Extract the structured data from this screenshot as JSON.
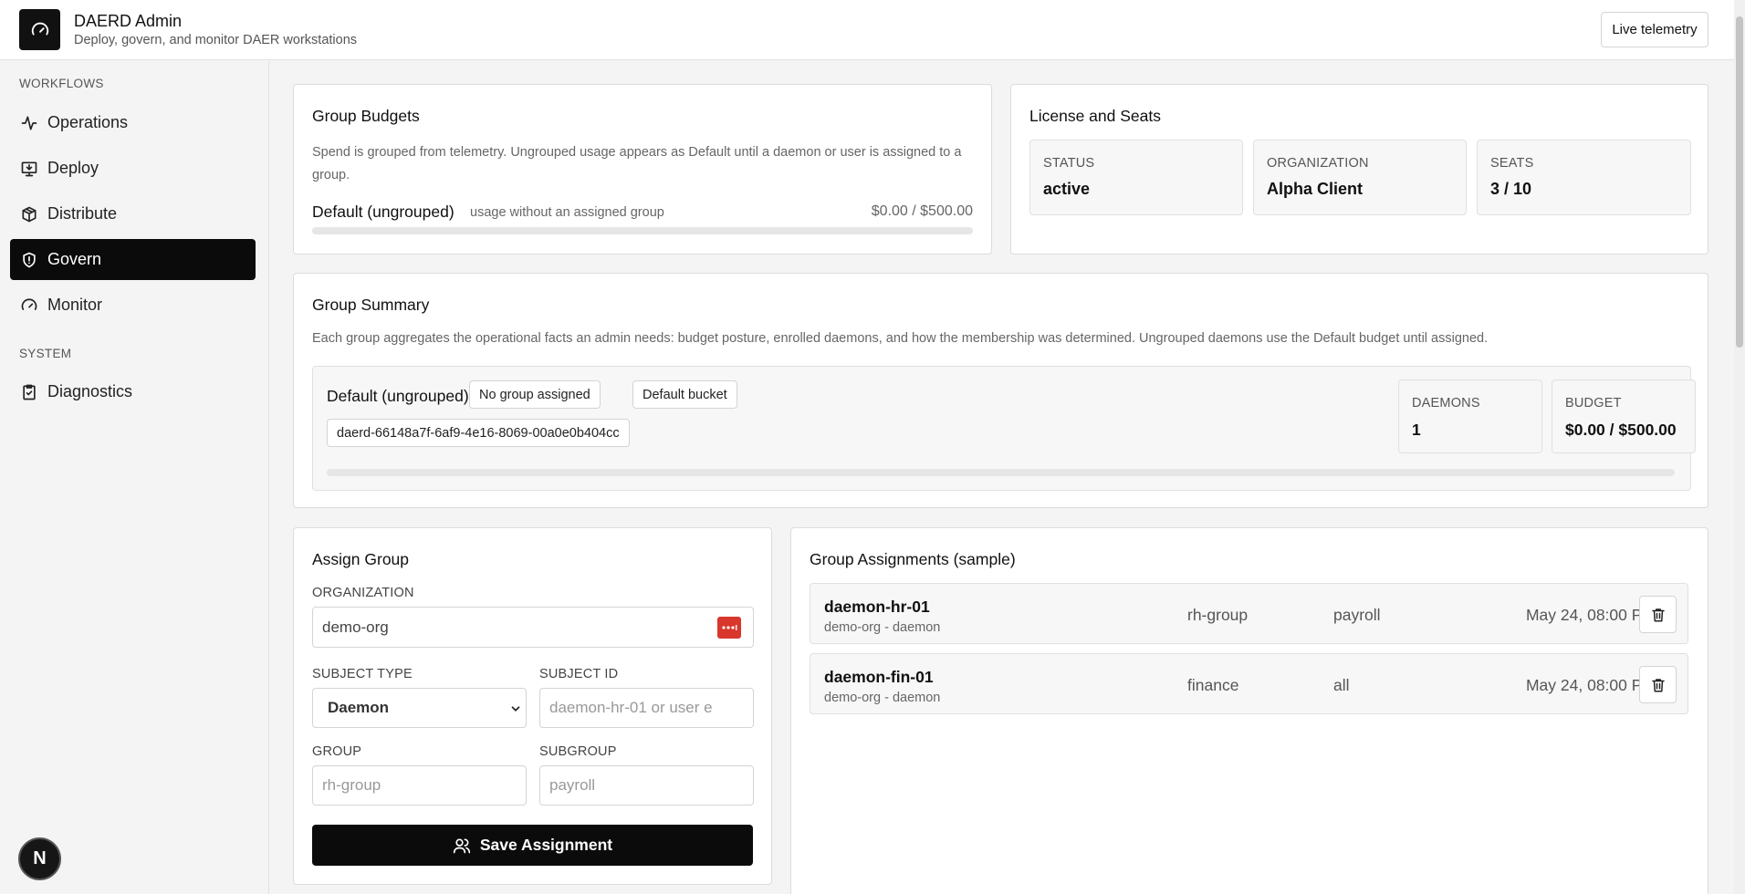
{
  "header": {
    "title": "DAERD Admin",
    "subtitle": "Deploy, govern, and monitor DAER workstations",
    "live_telemetry": "Live telemetry",
    "logo_icon": "gauge-icon"
  },
  "sidebar": {
    "workflows_label": "WORKFLOWS",
    "system_label": "SYSTEM",
    "items": [
      {
        "label": "Operations",
        "icon": "activity-icon"
      },
      {
        "label": "Deploy",
        "icon": "monitor-download-icon"
      },
      {
        "label": "Distribute",
        "icon": "package-icon"
      },
      {
        "label": "Govern",
        "icon": "shield-icon",
        "active": true
      },
      {
        "label": "Monitor",
        "icon": "gauge-icon"
      },
      {
        "label": "Diagnostics",
        "icon": "clipboard-check-icon"
      }
    ],
    "badge": "N"
  },
  "group_budgets": {
    "title": "Group Budgets",
    "description": "Spend is grouped from telemetry. Ungrouped usage appears as Default until a daemon or user is assigned to a group.",
    "row_name": "Default (ungrouped)",
    "row_note": "usage without an assigned group",
    "row_amount": "$0.00 / $500.00",
    "progress_fraction": 0
  },
  "license": {
    "title": "License and Seats",
    "tiles": [
      {
        "label": "STATUS",
        "value": "active"
      },
      {
        "label": "ORGANIZATION",
        "value": "Alpha Client"
      },
      {
        "label": "SEATS",
        "value": "3 / 10"
      }
    ]
  },
  "group_summary": {
    "title": "Group Summary",
    "description": "Each group aggregates the operational facts an admin needs: budget posture, enrolled daemons, and how the membership was determined. Ungrouped daemons use the Default budget until assigned.",
    "group_name": "Default (ungrouped)",
    "chips": [
      "No group assigned",
      "Default bucket"
    ],
    "daemon_id": "daerd-66148a7f-6af9-4e16-8069-00a0e0b404cc",
    "daemons_label": "DAEMONS",
    "daemons_value": "1",
    "budget_label": "BUDGET",
    "budget_value": "$0.00 / $500.00",
    "progress_fraction": 0
  },
  "assign_group": {
    "title": "Assign Group",
    "organization_label": "ORGANIZATION",
    "organization_value": "demo-org",
    "subject_type_label": "SUBJECT TYPE",
    "subject_type_value": "Daemon",
    "subject_id_label": "SUBJECT ID",
    "subject_id_placeholder": "daemon-hr-01 or user e",
    "group_label": "GROUP",
    "group_placeholder": "rh-group",
    "subgroup_label": "SUBGROUP",
    "subgroup_placeholder": "payroll",
    "save_label": "Save Assignment"
  },
  "assignments": {
    "title": "Group Assignments (sample)",
    "rows": [
      {
        "name": "daemon-hr-01",
        "meta": "demo-org - daemon",
        "group": "rh-group",
        "subgroup": "payroll",
        "date": "May 24, 08:00 PM"
      },
      {
        "name": "daemon-fin-01",
        "meta": "demo-org - daemon",
        "group": "finance",
        "subgroup": "all",
        "date": "May 24, 08:00 PM"
      }
    ]
  }
}
